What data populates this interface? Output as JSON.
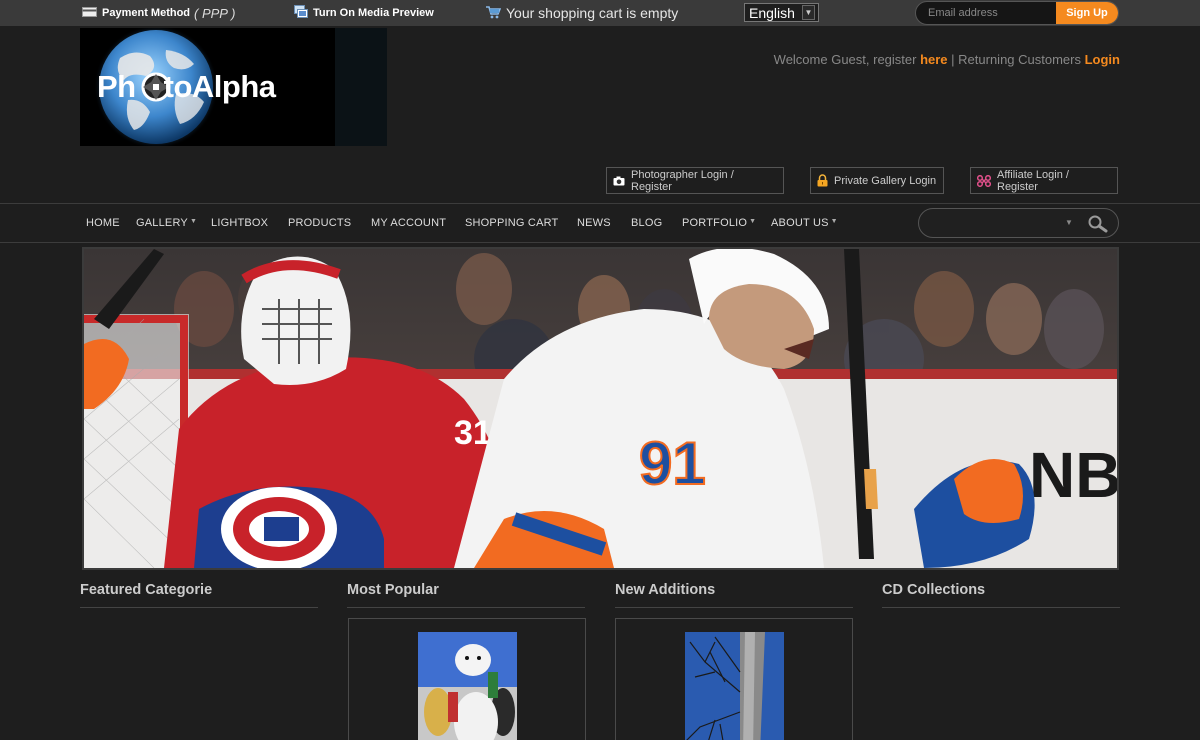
{
  "topbar": {
    "payment_label": "Payment Method",
    "payment_value": "( PPP )",
    "media_preview": "Turn On Media Preview",
    "cart_status": "Your shopping cart is empty",
    "language": "English",
    "email_placeholder": "Email address",
    "signup_label": "Sign Up"
  },
  "logo": {
    "text_a": "Ph",
    "text_b": "to",
    "text_c": "Alpha"
  },
  "welcome": {
    "prefix": "Welcome Guest, register ",
    "here": "here",
    "sep": " | ",
    "returning": "Returning Customers ",
    "login": "Login"
  },
  "login_buttons": {
    "photographer": "Photographer Login / Register",
    "private_gallery": "Private Gallery Login",
    "affiliate": "Affiliate Login / Register"
  },
  "nav": {
    "home": "HOME",
    "gallery": "GALLERY",
    "lightbox": "LIGHTBOX",
    "products": "PRODUCTS",
    "my_account": "MY ACCOUNT",
    "shopping_cart": "SHOPPING CART",
    "news": "NEWS",
    "blog": "BLOG",
    "portfolio": "PORTFOLIO",
    "about_us": "ABOUT US"
  },
  "banner": {
    "jersey_number_left": "31",
    "jersey_number_right": "91",
    "board_text": "NB"
  },
  "sections": {
    "featured": "Featured Categorie",
    "popular": "Most Popular",
    "new": "New Additions",
    "cd": "CD Collections"
  },
  "colors": {
    "accent": "#f58a1f",
    "background": "#1e1e1e",
    "topbar": "#3a3a3a"
  }
}
